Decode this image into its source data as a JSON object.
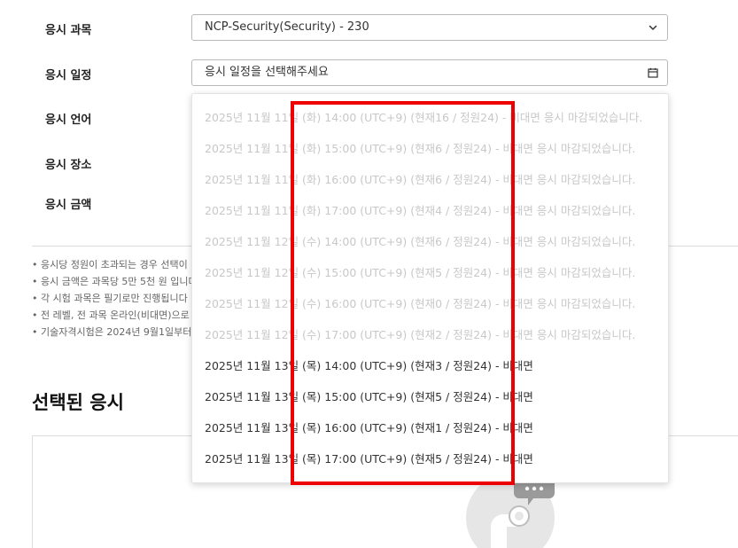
{
  "form": {
    "subject_label": "응시 과목",
    "schedule_label": "응시 일정",
    "language_label": "응시 언어",
    "location_label": "응시 장소",
    "fee_label": "응시 금액",
    "subject_value": "NCP-Security(Security) - 230",
    "schedule_placeholder": "응시 일정을 선택해주세요",
    "subject_icon": "chevron-down-icon",
    "schedule_icon": "calendar-icon"
  },
  "schedule_options": [
    {
      "label": "2025년 11월 11일 (화) 14:00 (UTC+9) (현재16 / 정원24) - 비대면 응시 마감되었습니다.",
      "disabled": true
    },
    {
      "label": "2025년 11월 11일 (화) 15:00 (UTC+9) (현재6 / 정원24) - 비대면 응시 마감되었습니다.",
      "disabled": true
    },
    {
      "label": "2025년 11월 11일 (화) 16:00 (UTC+9) (현재6 / 정원24) - 비대면 응시 마감되었습니다.",
      "disabled": true
    },
    {
      "label": "2025년 11월 11일 (화) 17:00 (UTC+9) (현재4 / 정원24) - 비대면 응시 마감되었습니다.",
      "disabled": true
    },
    {
      "label": "2025년 11월 12일 (수) 14:00 (UTC+9) (현재6 / 정원24) - 비대면 응시 마감되었습니다.",
      "disabled": true
    },
    {
      "label": "2025년 11월 12일 (수) 15:00 (UTC+9) (현재5 / 정원24) - 비대면 응시 마감되었습니다.",
      "disabled": true
    },
    {
      "label": "2025년 11월 12일 (수) 16:00 (UTC+9) (현재0 / 정원24) - 비대면 응시 마감되었습니다.",
      "disabled": true
    },
    {
      "label": "2025년 11월 12일 (수) 17:00 (UTC+9) (현재2 / 정원24) - 비대면 응시 마감되었습니다.",
      "disabled": true
    },
    {
      "label": "2025년 11월 13일 (목) 14:00 (UTC+9) (현재3 / 정원24) - 비대면",
      "disabled": false
    },
    {
      "label": "2025년 11월 13일 (목) 15:00 (UTC+9) (현재5 / 정원24) - 비대면",
      "disabled": false
    },
    {
      "label": "2025년 11월 13일 (목) 16:00 (UTC+9) (현재1 / 정원24) - 비대면",
      "disabled": false
    },
    {
      "label": "2025년 11월 13일 (목) 17:00 (UTC+9) (현재5 / 정원24) - 비대면",
      "disabled": false
    }
  ],
  "notes": [
    "• 응시당 정원이 초과되는 경우 선택이",
    "• 응시 금액은 과목당 5만 5천 원 입니다",
    "• 각 시험 과목은 필기로만 진행됩니다",
    "• 전 레벨, 전 과목 온라인(비대면)으로",
    "• 기술자격시험은 2024년 9월1일부터"
  ],
  "selected_section": {
    "title": "선택된 응시",
    "illustration_icon": "empty-chat-illustration"
  },
  "colors": {
    "highlight": "#ee0000",
    "disabled_text": "#c8c8c8",
    "enabled_text": "#333333",
    "border": "#b9b9b9"
  }
}
